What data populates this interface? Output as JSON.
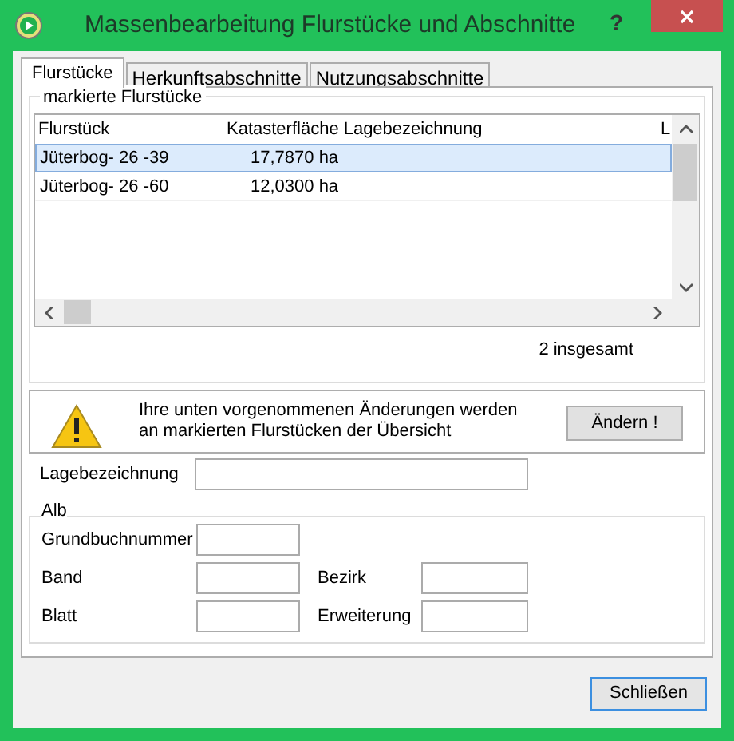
{
  "window": {
    "title": "Massenbearbeitung Flurstücke und Abschnitte",
    "help": "?"
  },
  "tabs": [
    {
      "label": "Flurstücke",
      "selected": true
    },
    {
      "label": "Herkunftsabschnitte",
      "selected": false
    },
    {
      "label": "Nutzungsabschnitte",
      "selected": false
    }
  ],
  "group": {
    "title": "markierte Flurstücke"
  },
  "table": {
    "columns": [
      "Flurstück",
      "Katasterfläche",
      "Lagebezeichnung",
      "L"
    ],
    "rows": [
      {
        "cells": [
          "Jüterbog- 26 -39",
          "17,7870 ha",
          ""
        ],
        "selected": true
      },
      {
        "cells": [
          "Jüterbog- 26 -60",
          "12,0300 ha",
          ""
        ],
        "selected": false
      }
    ]
  },
  "total": "2 insgesamt",
  "warning": {
    "lines": [
      "Ihre unten vorgenommenen Änderungen werden",
      "an markierten Flurstücken der Übersicht"
    ],
    "button": "Ändern !"
  },
  "lage": {
    "label": "Lagebezeichnung"
  },
  "alb": {
    "title": "Alb",
    "fields": [
      {
        "label": "Grundbuchnummer"
      },
      {
        "label": "Band"
      },
      {
        "label": "Bezirk"
      },
      {
        "label": "Blatt"
      },
      {
        "label": "Erweiterung"
      }
    ]
  },
  "close_button": "Schließen"
}
